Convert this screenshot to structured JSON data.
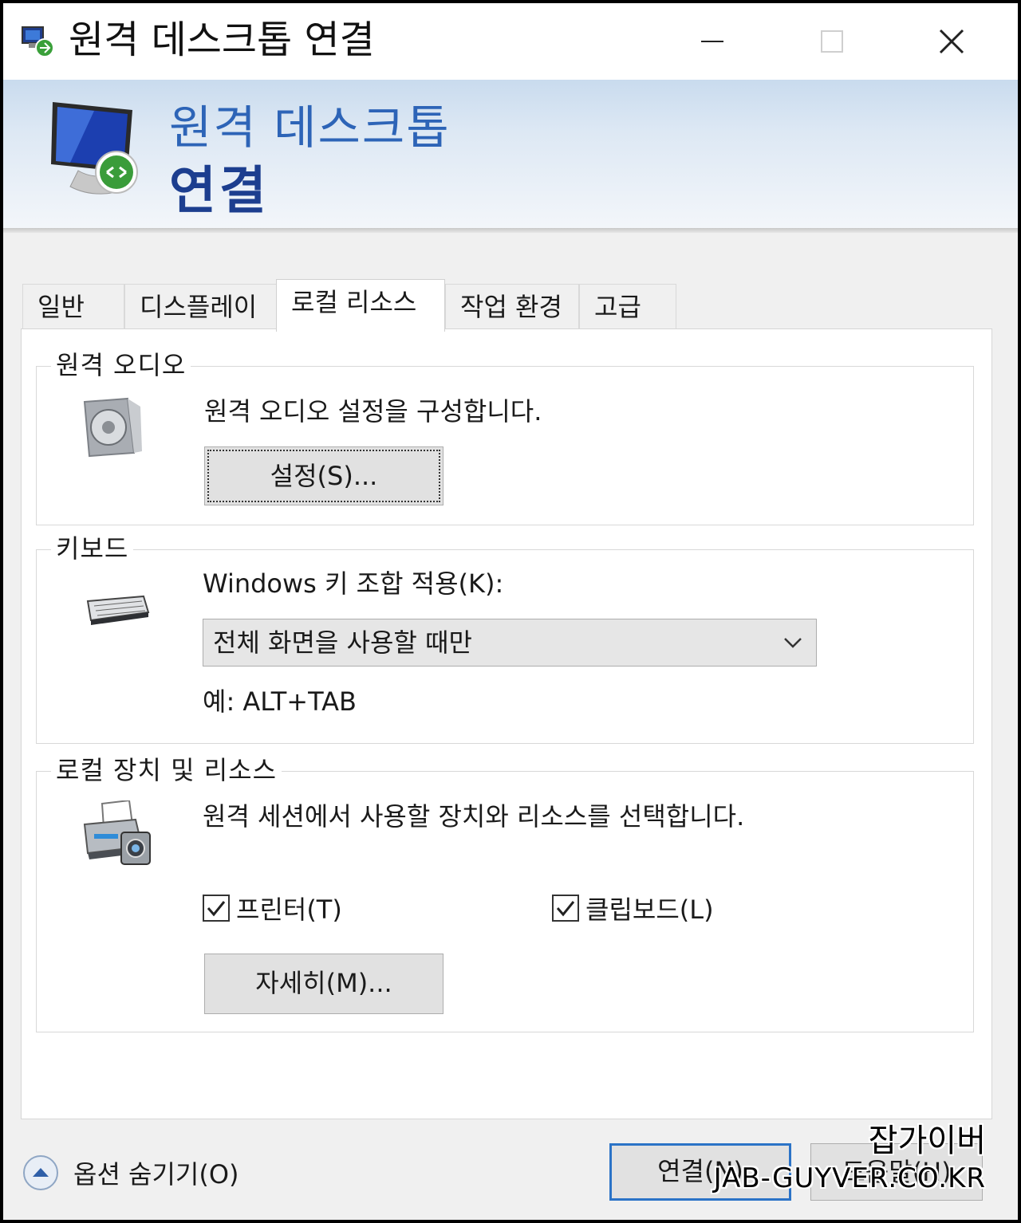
{
  "window": {
    "title": "원격 데스크톱 연결"
  },
  "banner": {
    "line1": "원격 데스크톱",
    "line2": "연결"
  },
  "tabs": [
    {
      "label": "일반"
    },
    {
      "label": "디스플레이"
    },
    {
      "label": "로컬 리소스",
      "active": true
    },
    {
      "label": "작업 환경"
    },
    {
      "label": "고급"
    }
  ],
  "audio": {
    "group_label": "원격 오디오",
    "description": "원격 오디오 설정을 구성합니다.",
    "settings_button": "설정(S)..."
  },
  "keyboard": {
    "group_label": "키보드",
    "combo_label": "Windows 키 조합 적용(K):",
    "combo_value": "전체 화면을 사용할 때만",
    "example": "예: ALT+TAB"
  },
  "local_devices": {
    "group_label": "로컬 장치 및 리소스",
    "description": "원격 세션에서 사용할 장치와 리소스를 선택합니다.",
    "printer_label": "프린터(T)",
    "printer_checked": true,
    "clipboard_label": "클립보드(L)",
    "clipboard_checked": true,
    "more_button": "자세히(M)..."
  },
  "footer": {
    "hide_options": "옵션 숨기기(O)",
    "connect_button": "연결(N)",
    "help_button": "도움말(H)"
  },
  "watermark": {
    "line1": "잡가이버",
    "line2": "JAB-GUYVER.CO.KR"
  },
  "colors": {
    "accent": "#2b73c7",
    "banner_title": "#2d64b7",
    "banner_title_bold": "#1c3e8f"
  }
}
